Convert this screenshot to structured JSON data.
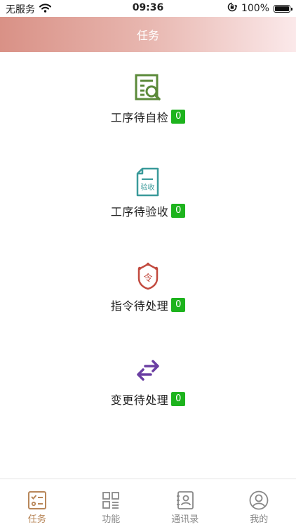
{
  "status_bar": {
    "carrier": "无服务",
    "time": "09:36",
    "battery_percent": "100%",
    "battery_level": 1.0
  },
  "header": {
    "title": "任务"
  },
  "tasks": [
    {
      "label": "工序待自检",
      "count": "0",
      "icon": "document-search-icon",
      "icon_color": "#5b8a3a"
    },
    {
      "label": "工序待验收",
      "count": "0",
      "icon": "acceptance-document-icon",
      "icon_color": "#3a9a9a",
      "icon_text": "验收"
    },
    {
      "label": "指令待处理",
      "count": "0",
      "icon": "command-badge-icon",
      "icon_color": "#c24a3f",
      "icon_text": "令"
    },
    {
      "label": "变更待处理",
      "count": "0",
      "icon": "exchange-arrows-icon",
      "icon_color": "#6b3fa3"
    }
  ],
  "tab_bar": {
    "active_color": "#b8875a",
    "inactive_color": "#888888",
    "tabs": [
      {
        "label": "任务",
        "icon": "task-checklist-icon",
        "active": true
      },
      {
        "label": "功能",
        "icon": "grid-apps-icon",
        "active": false
      },
      {
        "label": "通讯录",
        "icon": "contacts-book-icon",
        "active": false
      },
      {
        "label": "我的",
        "icon": "user-profile-icon",
        "active": false
      }
    ]
  },
  "colors": {
    "header_gradient_start": "#d99186",
    "header_gradient_end": "#fbe9ea",
    "badge_bg": "#1db31d"
  }
}
